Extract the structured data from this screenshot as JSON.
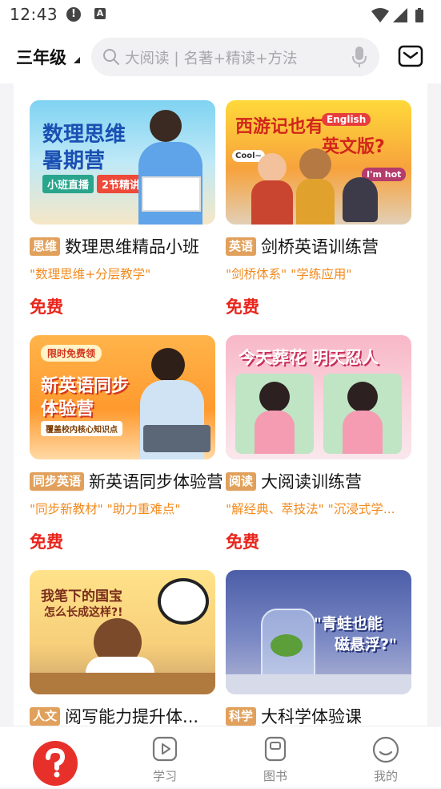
{
  "status_bar": {
    "time": "12:43",
    "alert_glyph": "!",
    "a_glyph": "A"
  },
  "header": {
    "grade": "三年级",
    "search_placeholder": "大阅读 | 名著+精读+方法"
  },
  "cards": [
    {
      "tag": "思维",
      "title": "数理思维精品小班",
      "subtitle": "\"数理思维+分层教学\"",
      "price": "免费",
      "thumb_text": [
        "数理思维",
        "暑期营",
        "小班直播",
        "2节精讲"
      ]
    },
    {
      "tag": "英语",
      "title": "剑桥英语训练营",
      "subtitle": "\"剑桥体系\" \"学练应用\"",
      "price": "免费",
      "thumb_text": [
        "西游记也有",
        "英文版?",
        "English",
        "I'm hot",
        "Cool~"
      ]
    },
    {
      "tag": "同步英语",
      "title": "新英语同步体验营",
      "subtitle": "\"同步新教材\" \"助力重难点\"",
      "price": "免费",
      "thumb_text": [
        "限时免费领",
        "新英语同步",
        "体验营",
        "覆盖校内核心知识点"
      ]
    },
    {
      "tag": "阅读",
      "title": "大阅读训练营",
      "subtitle": "\"解经典、萃技法\" \"沉浸式学...",
      "price": "免费",
      "thumb_text": [
        "今天葬花 明天忍人"
      ]
    },
    {
      "tag": "人文",
      "title": "阅写能力提升体...",
      "subtitle": "",
      "price": "",
      "thumb_text": [
        "我笔下的国宝",
        "怎么长成这样?!"
      ]
    },
    {
      "tag": "科学",
      "title": "大科学体验课",
      "subtitle": "",
      "price": "",
      "thumb_text": [
        "\"青蛙也能",
        "磁悬浮?\""
      ]
    }
  ],
  "bottom_nav": {
    "items": [
      {
        "label": "",
        "icon": "question-home-icon",
        "active": true
      },
      {
        "label": "学习",
        "icon": "play-icon"
      },
      {
        "label": "图书",
        "icon": "book-icon"
      },
      {
        "label": "我的",
        "icon": "smile-icon"
      }
    ]
  },
  "colors": {
    "accent_red": "#e8302a",
    "tag_bg": "#e1a15c",
    "subtitle_orange": "#f28a1d",
    "price_red": "#e8241b"
  }
}
